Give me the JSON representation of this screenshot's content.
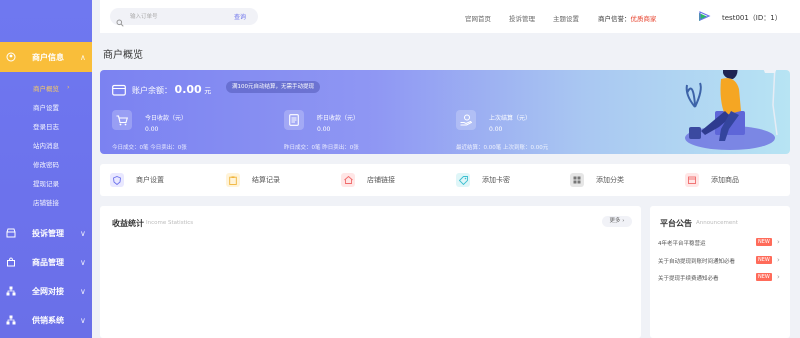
{
  "sidebar": {
    "groups": [
      {
        "label": "商户信息",
        "icon": "user-icon"
      },
      {
        "label": "投诉管理",
        "icon": "shop-icon"
      },
      {
        "label": "商品管理",
        "icon": "bag-icon"
      },
      {
        "label": "全网对接",
        "icon": "network-icon"
      },
      {
        "label": "供销系统",
        "icon": "network-icon"
      }
    ],
    "sub_items": [
      "商户概览",
      "商户设置",
      "登录日志",
      "站内消息",
      "修改密码",
      "提现记录",
      "店铺链接"
    ],
    "active_sub_arrow": "›"
  },
  "topbar": {
    "search_placeholder": "输入订单号",
    "search_button": "查询",
    "links": [
      "官网首页",
      "投诉管理",
      "主题设置"
    ],
    "deposit_label": "商户信誉：",
    "deposit_value": "优质商家",
    "username": "test001（ID：1）",
    "caret": "∨"
  },
  "page_title": "商户概览",
  "hero": {
    "balance_label": "账户余额：",
    "balance_value": "0.00",
    "balance_unit": "元",
    "tag": "满100元自动结算，无需手动提现",
    "stats": [
      {
        "label": "今日收款（元）",
        "value": "0.00",
        "foot": "今日成交：0笔    今日卖出：0张"
      },
      {
        "label": "昨日收款（元）",
        "value": "0.00",
        "foot": "昨日成交：0笔    昨日卖出：0张"
      },
      {
        "label": "上次结算（元）",
        "value": "0.00",
        "foot": "最近结算：0.00笔    上次到账：0.00元"
      }
    ]
  },
  "quick_actions": [
    {
      "label": "商户设置",
      "icon": "shield-icon",
      "color": "#e9e8ff"
    },
    {
      "label": "结算记录",
      "icon": "clipboard-icon",
      "color": "#fff3d8"
    },
    {
      "label": "店铺链接",
      "icon": "house-icon",
      "color": "#ffe6e6"
    },
    {
      "label": "添加卡密",
      "icon": "tag-icon",
      "color": "#dff6f8"
    },
    {
      "label": "添加分类",
      "icon": "grid-icon",
      "color": "#e6e6e6"
    },
    {
      "label": "添加商品",
      "icon": "calendar-icon",
      "color": "#ffe6e6"
    }
  ],
  "revenue": {
    "title": "收益统计",
    "subtitle": "Income Statistics",
    "more": "更多 ›"
  },
  "announcements": {
    "title": "平台公告",
    "subtitle": "Announcement",
    "items": [
      {
        "text": "4年老平台平稳营运",
        "badge": "NEW"
      },
      {
        "text": "关于自动提现到账时间通知必看",
        "badge": "NEW"
      },
      {
        "text": "关于提现手续费通知必看",
        "badge": "NEW"
      }
    ],
    "arrow": "›"
  },
  "colors": {
    "accent": "#6c72ec",
    "active": "#f9be3a",
    "danger": "#e7402b"
  }
}
